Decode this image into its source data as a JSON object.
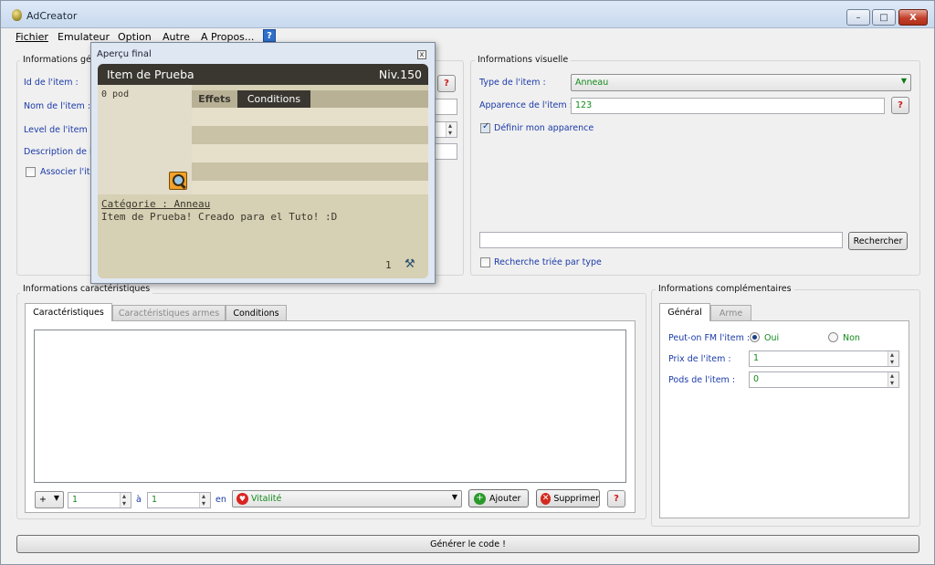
{
  "window": {
    "title": "AdCreator",
    "min": "–",
    "max": "□",
    "close": "X"
  },
  "menu": [
    "Fichier",
    "Emulateur",
    "Option",
    "Autre",
    "A Propos...",
    "?"
  ],
  "general": {
    "title": "Informations gén",
    "id_label": "Id de l'item :",
    "name_label": "Nom de l'item :",
    "level_label": "Level de l'item :",
    "desc_label": "Description de l'i",
    "assoc_label": "Associer l'ite",
    "help": "?"
  },
  "visual": {
    "title": "Informations visuelle",
    "type_label": "Type de l'item :",
    "type_value": "Anneau",
    "appearance_label": "Apparence de l'item :",
    "appearance_value": "123",
    "define_label": "Définir mon apparence",
    "define_checked": true,
    "search_button": "Rechercher",
    "sorted_label": "Recherche triée par type",
    "help": "?"
  },
  "preview": {
    "title": "Aperçu final",
    "close": "x",
    "item_name": "Item de Prueba",
    "level": "Niv.150",
    "weight": "0 pod",
    "tab_effects": "Effets",
    "tab_conditions": "Conditions",
    "category": "Catégorie : Anneau",
    "description": "Item de Prueba! Creado para el Tuto! :D",
    "quantity": "1"
  },
  "characteristics": {
    "title": "Informations caractéristiques",
    "tabs": [
      "Caractéristiques",
      "Caractéristiques armes",
      "Conditions"
    ],
    "plus": "+",
    "from_value": "1",
    "to_label": "à",
    "to_value": "1",
    "en_label": "en",
    "stat_value": "Vitalité",
    "add_button": "Ajouter",
    "delete_button": "Supprimer",
    "help": "?"
  },
  "complementary": {
    "title": "Informations complémentaires",
    "tabs": [
      "Général",
      "Arme"
    ],
    "fm_label": "Peut-on FM l'item :",
    "yes": "Oui",
    "no": "Non",
    "price_label": "Prix de l'item :",
    "price_value": "1",
    "pods_label": "Pods de l'item :",
    "pods_value": "0"
  },
  "generate_button": "Générer le code !",
  "colors": {
    "accent_text": "#1b3aa8",
    "value_text": "#138a1a",
    "card_header": "#3a3731",
    "card_bg": "#d6d0b4"
  }
}
